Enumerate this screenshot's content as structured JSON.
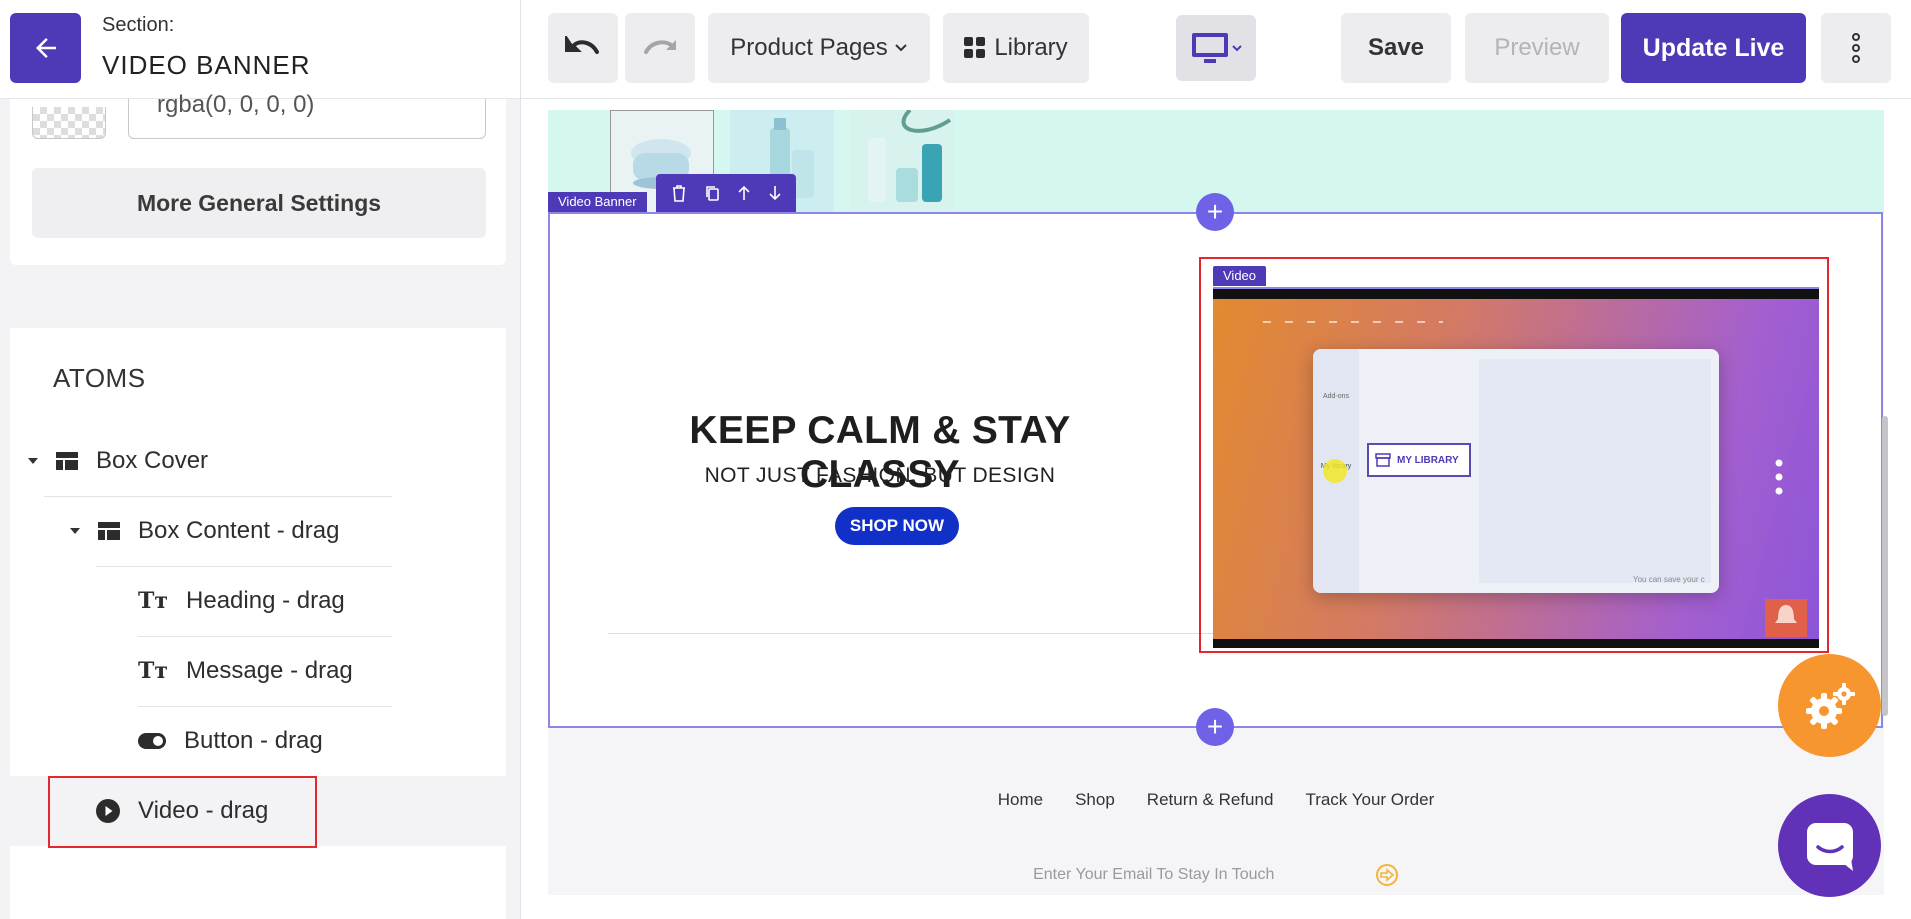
{
  "sidebar": {
    "section_label": "Section:",
    "section_name": "VIDEO BANNER",
    "color_value": "rgba(0, 0, 0, 0)",
    "more_settings_label": "More General Settings",
    "atoms_title": "ATOMS",
    "tree": [
      {
        "label": "Box Cover",
        "icon": "layout-icon"
      },
      {
        "label": "Box Content - drag",
        "icon": "layout-icon"
      },
      {
        "label": "Heading - drag",
        "icon": "text-icon"
      },
      {
        "label": "Message - drag",
        "icon": "text-icon"
      },
      {
        "label": "Button - drag",
        "icon": "toggle-icon"
      },
      {
        "label": "Video - drag",
        "icon": "play-icon"
      }
    ]
  },
  "toolbar": {
    "pages_label": "Product Pages",
    "library_label": "Library",
    "save_label": "Save",
    "preview_label": "Preview",
    "update_label": "Update Live"
  },
  "canvas": {
    "banner_label": "Video Banner",
    "video_label": "Video",
    "heading": "KEEP CALM & STAY CLASSY",
    "message": "NOT JUST FASHION, BUT DESIGN",
    "button_label": "SHOP NOW",
    "video": {
      "addons_label": "Add-ons",
      "library_label": "My library",
      "my_library_badge": "MY LIBRARY",
      "caption": "You can save your c"
    },
    "footer_nav": [
      "Home",
      "Shop",
      "Return & Refund",
      "Track Your Order"
    ],
    "email_placeholder": "Enter Your Email To Stay In Touch"
  },
  "colors": {
    "accent": "#4e3ab7",
    "selection_red": "#e4262f",
    "shop_button": "#1030c8",
    "gear_fab": "#f7962f",
    "chat_fab": "#6131b8",
    "mint": "#d4f8f0"
  }
}
